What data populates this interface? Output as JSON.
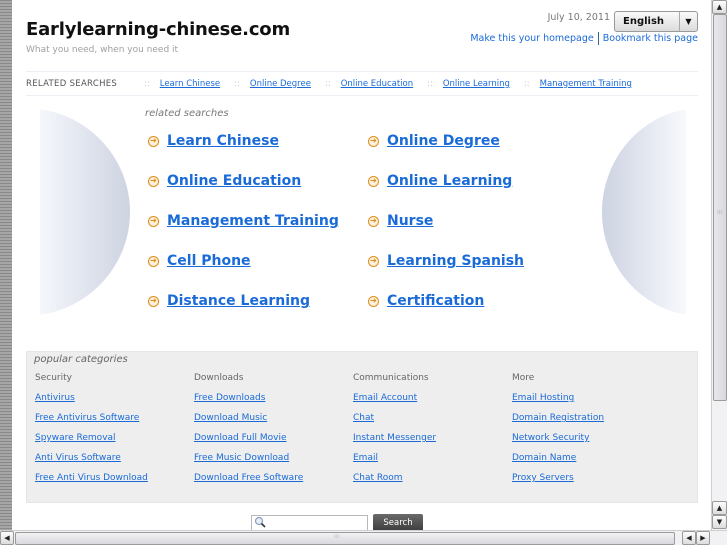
{
  "header": {
    "site_title": "Earlylearning-chinese.com",
    "tagline": "What you need, when you need it",
    "date": "July 10, 2011",
    "language": "English",
    "make_homepage": "Make this your homepage",
    "bookmark": "Bookmark this page"
  },
  "related_bar": {
    "title": "RELATED SEARCHES",
    "separator": "::",
    "links": [
      "Learn Chinese",
      "Online Degree",
      "Online Education",
      "Online Learning",
      "Management Training"
    ]
  },
  "related_searches": {
    "heading": "related searches",
    "items": [
      "Learn Chinese",
      "Online Degree",
      "Online Education",
      "Online Learning",
      "Management Training",
      "Nurse",
      "Cell Phone",
      "Learning Spanish",
      "Distance Learning",
      "Certification"
    ]
  },
  "popular": {
    "heading": "popular categories",
    "columns": [
      {
        "title": "Security",
        "links": [
          "Antivirus",
          "Free Antivirus Software",
          "Spyware Removal",
          "Anti Virus Software",
          "Free Anti Virus Download"
        ]
      },
      {
        "title": "Downloads",
        "links": [
          "Free Downloads",
          "Download Music",
          "Download Full Movie",
          "Free Music Download",
          "Download Free Software"
        ]
      },
      {
        "title": "Communications",
        "links": [
          "Email Account",
          "Chat",
          "Instant Messenger",
          "Email",
          "Chat Room"
        ]
      },
      {
        "title": "More",
        "links": [
          "Email Hosting",
          "Domain Registration",
          "Network Security",
          "Domain Name",
          "Proxy Servers"
        ]
      }
    ]
  },
  "search": {
    "placeholder": "",
    "button_label": "Search"
  },
  "colors": {
    "link": "#1a6bd8",
    "arrow_icon": "#e08b1a",
    "popular_bg": "#eeeeee"
  }
}
